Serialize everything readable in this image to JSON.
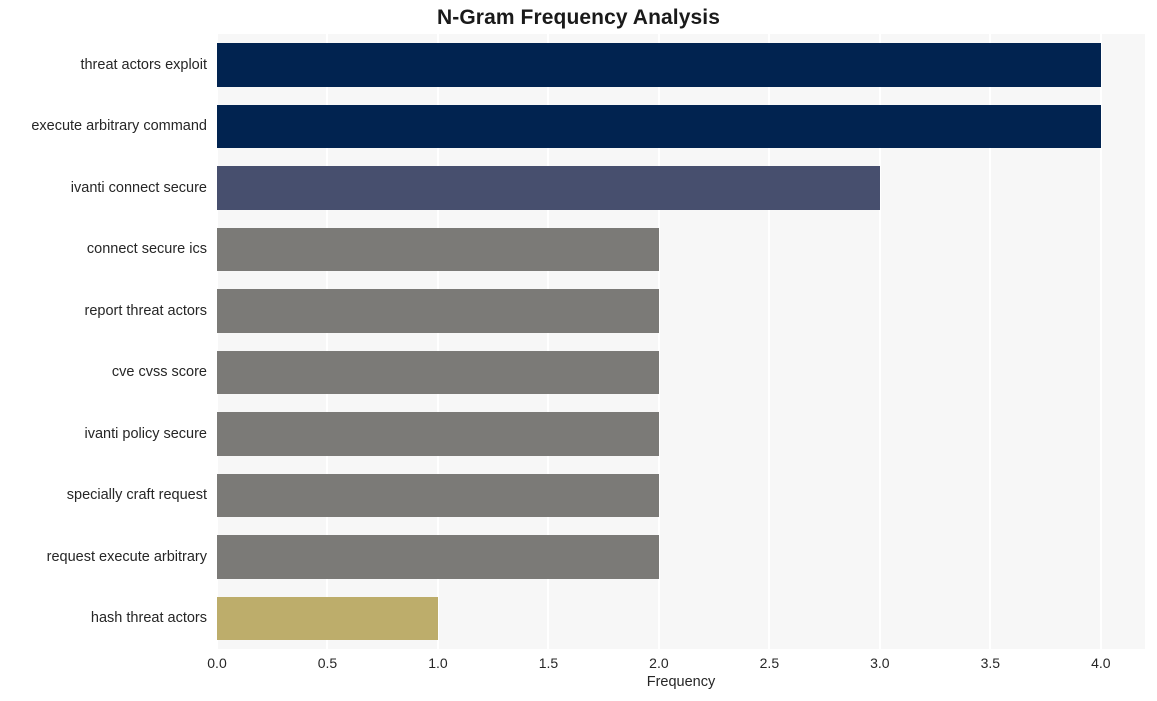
{
  "chart_data": {
    "type": "bar",
    "orientation": "horizontal",
    "title": "N-Gram Frequency Analysis",
    "xlabel": "Frequency",
    "ylabel": "",
    "xlim": [
      0.0,
      4.2
    ],
    "xticks": [
      "0.0",
      "0.5",
      "1.0",
      "1.5",
      "2.0",
      "2.5",
      "3.0",
      "3.5",
      "4.0"
    ],
    "xtick_values": [
      0.0,
      0.5,
      1.0,
      1.5,
      2.0,
      2.5,
      3.0,
      3.5,
      4.0
    ],
    "grid": "vertical-white-on-light-gray",
    "legend": "none",
    "categories": [
      "threat actors exploit",
      "execute arbitrary command",
      "ivanti connect secure",
      "connect secure ics",
      "report threat actors",
      "cve cvss score",
      "ivanti policy secure",
      "specially craft request",
      "request execute arbitrary",
      "hash threat actors"
    ],
    "values": [
      4,
      4,
      3,
      2,
      2,
      2,
      2,
      2,
      2,
      1
    ],
    "bar_colors": [
      "#012350",
      "#012350",
      "#474f6e",
      "#7b7a77",
      "#7b7a77",
      "#7b7a77",
      "#7b7a77",
      "#7b7a77",
      "#7b7a77",
      "#bdad6b"
    ]
  },
  "style": {
    "figure_background": "#ffffff",
    "axes_background": "#f7f7f7",
    "gridline_color": "#ffffff",
    "text_color": "#262626",
    "title_color": "#1a1a1a"
  }
}
